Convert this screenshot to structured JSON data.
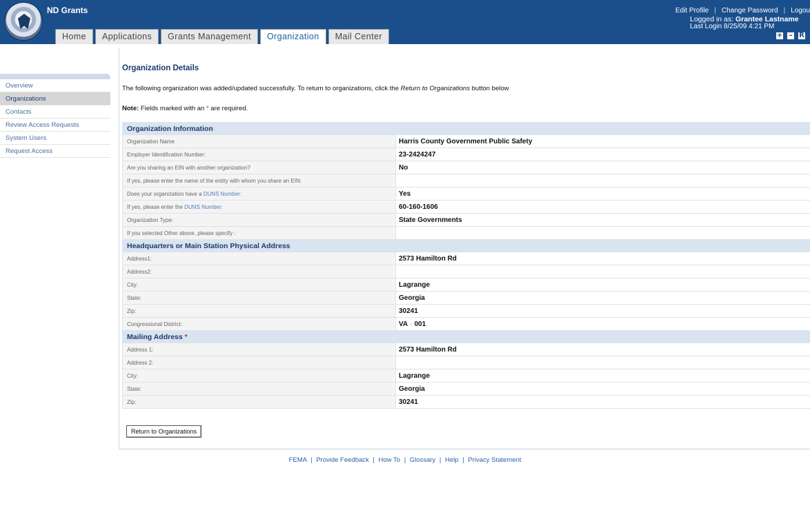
{
  "app": {
    "title": "ND Grants"
  },
  "tabs": [
    {
      "label": "Home"
    },
    {
      "label": "Applications"
    },
    {
      "label": "Grants Management"
    },
    {
      "label": "Organization"
    },
    {
      "label": "Mail Center"
    }
  ],
  "top": {
    "edit_profile": "Edit Profile",
    "change_password": "Change Password",
    "logout": "Logou",
    "logged_in_prefix": "Logged in as: ",
    "user_name": "Grantee Lastname",
    "last_login": "Last Login 8/25/09 4:21 PM"
  },
  "window_controls": {
    "plus": "+",
    "minus": "–",
    "restore": "R"
  },
  "sidebar": {
    "items": [
      {
        "label": "Overview"
      },
      {
        "label": "Organizations"
      },
      {
        "label": "Contacts"
      },
      {
        "label": "Review Access Requests"
      },
      {
        "label": "System Users"
      },
      {
        "label": "Request Access"
      }
    ]
  },
  "main": {
    "title": "Organization Details",
    "message_pre": "The following organization was added/updated successfully. To return to organizations, click the ",
    "message_em": "Return to Organizations",
    "message_post": " button below",
    "note_label": "Note:",
    "note_pre": " Fields marked with an ",
    "note_star": "*",
    "note_post": " are required.",
    "return_button": "Return to Organizations"
  },
  "org_info": {
    "heading": "Organization Information",
    "org_name_label": "Organization Name",
    "org_name_value": "Harris County Government Public Safety",
    "ein_label": "Employer Identification Number:",
    "ein_value": "23-2424247",
    "share_ein_label": "Are you sharing an EIN with another organization?",
    "share_ein_value": "No",
    "share_entity_label": "If yes, please enter the name of the entity with whom you share an EIN:",
    "share_entity_value": "",
    "duns_have_pre": "Does your organization have a ",
    "duns_have_link": "DUNS Number:",
    "duns_have_value": "Yes",
    "duns_enter_pre": "If yes, please enter the ",
    "duns_enter_link": "DUNS Number:",
    "duns_enter_value": "60-160-1606",
    "org_type_label": "Organization Type:",
    "org_type_value": "State Governments",
    "other_label": "If you selected Other above, please specify :",
    "other_value": ""
  },
  "hq": {
    "heading": "Headquarters or Main Station Physical Address",
    "address1_label": "Address1:",
    "address1_value": "2573 Hamilton Rd",
    "address2_label": "Address2:",
    "address2_value": "",
    "city_label": "City:",
    "city_value": "Lagrange",
    "state_label": "State:",
    "state_value": "Georgia",
    "zip_label": "Zip:",
    "zip_value": "30241",
    "cd_label": "Congressional District:",
    "cd_state": "VA",
    "cd_sep": "-",
    "cd_number": "001"
  },
  "mailing": {
    "heading": "Mailing Address",
    "heading_star": "*",
    "address1_label": "Address 1:",
    "address1_value": "2573 Hamilton Rd",
    "address2_label": "Address 2:",
    "address2_value": "",
    "city_label": "City:",
    "city_value": "Lagrange",
    "state_label": "State:",
    "state_value": "Georgia",
    "zip_label": "Zip:",
    "zip_value": "30241"
  },
  "footer": {
    "links": [
      "FEMA",
      "Provide Feedback",
      "How To",
      "Glossary",
      "Help",
      "Privacy Statement"
    ],
    "separator": "|"
  }
}
